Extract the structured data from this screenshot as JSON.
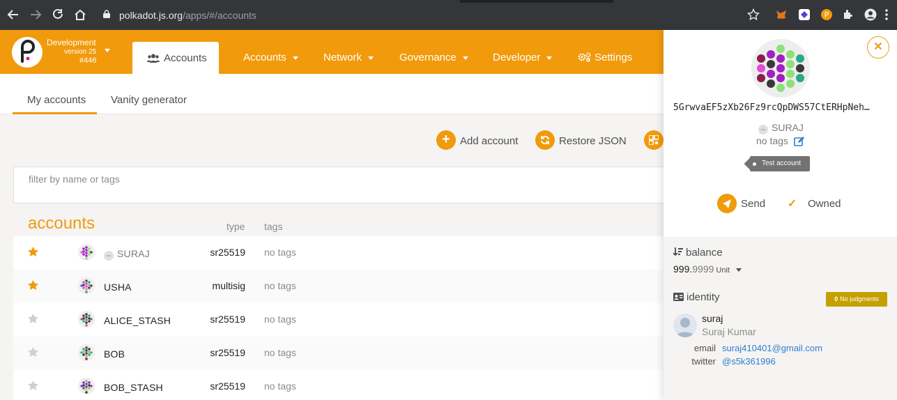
{
  "browser": {
    "url_host": "polkadot.js.org",
    "url_path": "/apps/#/accounts"
  },
  "header": {
    "chain_name": "Development",
    "chain_version": "version 25",
    "chain_block": "#446",
    "active_tab": "Accounts",
    "menu": [
      {
        "label": "Accounts"
      },
      {
        "label": "Network"
      },
      {
        "label": "Governance"
      },
      {
        "label": "Developer"
      },
      {
        "label": "Settings"
      }
    ]
  },
  "subnav": {
    "tabs": [
      {
        "label": "My accounts"
      },
      {
        "label": "Vanity generator"
      }
    ]
  },
  "actions": {
    "add_account": "Add account",
    "restore_json": "Restore JSON"
  },
  "filter": {
    "placeholder": "filter by name or tags"
  },
  "accounts": {
    "title": "accounts",
    "col_type": "type",
    "col_tags": "tags",
    "rows": [
      {
        "name": "SURAJ",
        "type": "sr25519",
        "tags": "no tags",
        "favorite": true
      },
      {
        "name": "USHA",
        "type": "multisig",
        "tags": "no tags",
        "favorite": true
      },
      {
        "name": "ALICE_STASH",
        "type": "sr25519",
        "tags": "no tags",
        "favorite": false
      },
      {
        "name": "BOB",
        "type": "sr25519",
        "tags": "no tags",
        "favorite": false
      },
      {
        "name": "BOB_STASH",
        "type": "sr25519",
        "tags": "no tags",
        "favorite": false
      }
    ]
  },
  "sidebar": {
    "address": "5GrwvaEF5zXb26Fz9rcQpDWS57CtERHpNeh…",
    "name": "SURAJ",
    "tags": "no tags",
    "tag_pill": "Test account",
    "send": "Send",
    "owned": "Owned",
    "balance_label": "balance",
    "balance_int": "999.",
    "balance_frac": "9999",
    "balance_unit": "Unit",
    "identity_label": "identity",
    "judgments_count": "0",
    "judgments_label": "No judgments",
    "display_name": "suraj",
    "legal_name": "Suraj Kumar",
    "email_label": "email",
    "email": "suraj410401@gmail.com",
    "twitter_label": "twitter",
    "twitter": "@s5k361996"
  },
  "colors": {
    "accent": "#f19a0b",
    "browser_bg": "#35363a",
    "link": "#2f7ecb",
    "judgment": "#c4a000"
  }
}
